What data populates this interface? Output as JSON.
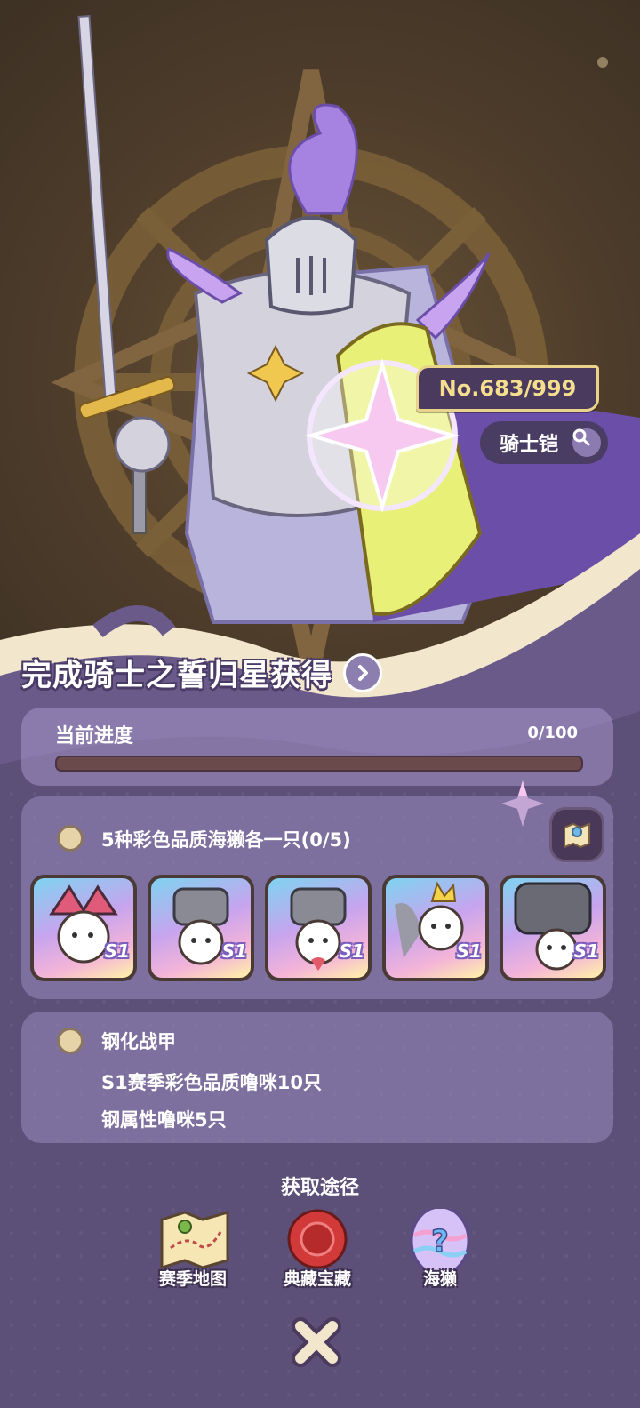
{
  "artwork": {
    "number_badge": "No.683/999",
    "name": "骑士铠",
    "sword_icon": "sword-icon",
    "shield_icon": "shield-icon"
  },
  "header": {
    "title": "完成骑士之誓归星获得"
  },
  "progress": {
    "label": "当前进度",
    "value_text": "0/100",
    "fraction": 0.0
  },
  "task1": {
    "text": "5种彩色品质海獭各一只(0/5)",
    "pets": [
      {
        "tag": "S1",
        "icon": "jester-otter-icon"
      },
      {
        "tag": "S1",
        "icon": "knight-otter-icon"
      },
      {
        "tag": "S1",
        "icon": "knight-otter-icon"
      },
      {
        "tag": "S1",
        "icon": "crown-otter-icon"
      },
      {
        "tag": "S1",
        "icon": "helmet-otter-icon"
      }
    ]
  },
  "task2": {
    "title": "钢化战甲",
    "line1": "S1赛季彩色品质噜咪10只",
    "line2": "钢属性噜咪5只"
  },
  "sources": {
    "title": "获取途径",
    "items": [
      {
        "label": "赛季地图",
        "icon": "map-icon"
      },
      {
        "label": "典藏宝藏",
        "icon": "treasure-seal-icon"
      },
      {
        "label": "海獭",
        "icon": "mystery-egg-icon"
      }
    ]
  },
  "colors": {
    "panel": "#5c4f78",
    "gold": "#f5df8f",
    "accent": "#8c7fb0"
  }
}
